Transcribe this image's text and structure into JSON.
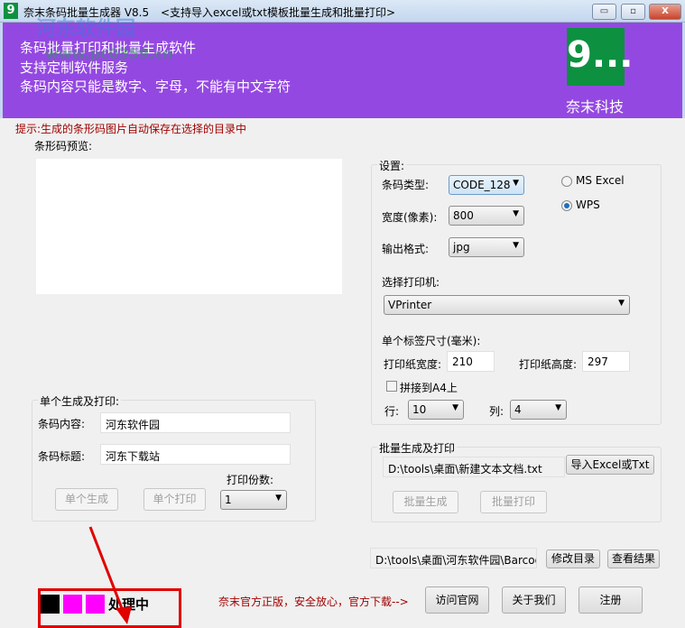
{
  "window": {
    "title": "奈末条码批量生成器 V8.5",
    "subtitle": "<支持导入excel或txt模板批量生成和批量打印>",
    "minimize": "▭",
    "maximize": "▫",
    "close": "X"
  },
  "watermark": {
    "name": "河东软件园",
    "url": "www.pc0359.cn"
  },
  "banner": {
    "lines": [
      "条码批量打印和批量生成软件",
      "支持定制软件服务",
      "条码内容只能是数字、字母，不能有中文字符"
    ],
    "logo_text": "9...",
    "company": "奈末科技",
    "color": "#9448e2"
  },
  "hint": "提示:生成的条形码图片自动保存在选择的目录中",
  "preview": {
    "label": "条形码预览:"
  },
  "settings": {
    "label": "设置:",
    "barcode_type_label": "条码类型:",
    "barcode_type": "CODE_128",
    "width_label": "宽度(像素):",
    "width": "800",
    "format_label": "输出格式:",
    "format": "jpg",
    "radio_excel": "MS  Excel",
    "radio_wps": "WPS",
    "selected_radio": "WPS",
    "printer_label": "选择打印机:",
    "printer": "VPrinter",
    "label_size": "单个标签尺寸(毫米):",
    "paper_width_label": "打印纸宽度:",
    "paper_width": "210",
    "paper_height_label": "打印纸高度:",
    "paper_height": "297",
    "a4_label": "拼接到A4上",
    "a4_checked": false,
    "rows_label": "行:",
    "rows": "10",
    "cols_label": "列:",
    "cols": "4"
  },
  "single": {
    "label": "单个生成及打印:",
    "content_label": "条码内容:",
    "content": "河东软件园",
    "title_label": "条码标题:",
    "title": "河东下载站",
    "copies_label": "打印份数:",
    "copies": "1",
    "generate": "单个生成",
    "print": "单个打印"
  },
  "batch": {
    "label": "批量生成及打印",
    "file": "D:\\tools\\桌面\\新建文本文档.txt",
    "import": "导入Excel或Txt",
    "generate": "批量生成",
    "print": "批量打印"
  },
  "output": {
    "path": "D:\\tools\\桌面\\河东软件园\\Barcode",
    "change_dir": "修改目录",
    "view_result": "查看结果"
  },
  "status": {
    "text": "处理中",
    "colors": [
      "#000000",
      "#ff00ff",
      "#ff00ff"
    ]
  },
  "footer": {
    "promo": "奈末官方正版，安全放心，官方下载-->",
    "visit": "访问官网",
    "about": "关于我们",
    "register": "注册"
  }
}
